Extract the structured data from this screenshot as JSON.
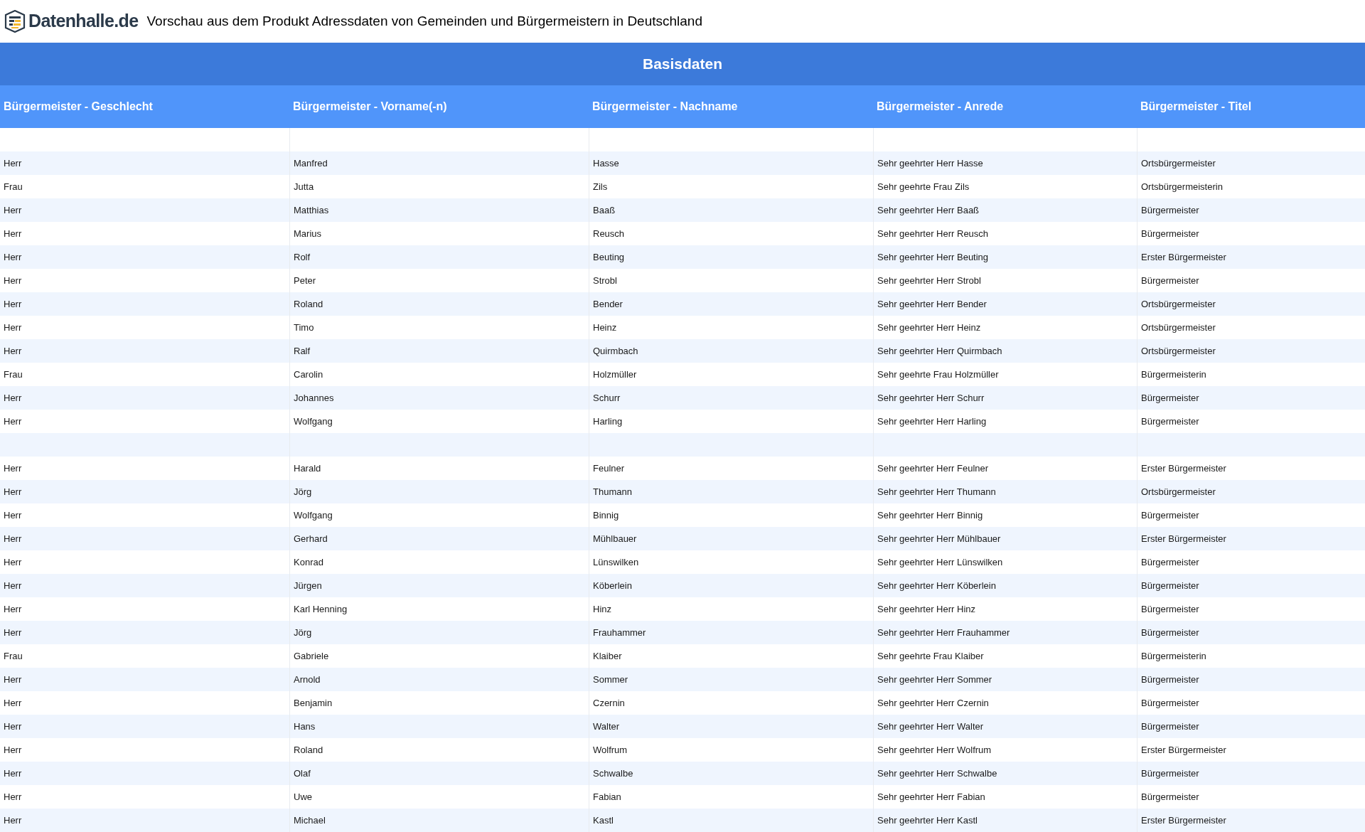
{
  "header": {
    "logo_text": "Datenhalle.de",
    "title": "Vorschau aus dem Produkt Adressdaten von Gemeinden und Bürgermeistern in Deutschland"
  },
  "table": {
    "group_title": "Basisdaten",
    "columns": [
      "Bürgermeister - Geschlecht",
      "Bürgermeister - Vorname(-n)",
      "Bürgermeister - Nachname",
      "Bürgermeister - Anrede",
      "Bürgermeister - Titel"
    ],
    "rows": [
      {
        "kind": "blank"
      },
      {
        "kind": "data",
        "cells": [
          "Herr",
          "Manfred",
          "Hasse",
          "Sehr geehrter Herr Hasse",
          "Ortsbürgermeister"
        ]
      },
      {
        "kind": "data",
        "cells": [
          "Frau",
          "Jutta",
          "Zils",
          "Sehr geehrte Frau Zils",
          "Ortsbürgermeisterin"
        ]
      },
      {
        "kind": "data",
        "cells": [
          "Herr",
          "Matthias",
          "Baaß",
          "Sehr geehrter Herr Baaß",
          "Bürgermeister"
        ]
      },
      {
        "kind": "data",
        "cells": [
          "Herr",
          "Marius",
          "Reusch",
          "Sehr geehrter Herr Reusch",
          "Bürgermeister"
        ]
      },
      {
        "kind": "data",
        "cells": [
          "Herr",
          "Rolf",
          "Beuting",
          "Sehr geehrter Herr Beuting",
          "Erster Bürgermeister"
        ]
      },
      {
        "kind": "data",
        "cells": [
          "Herr",
          "Peter",
          "Strobl",
          "Sehr geehrter Herr Strobl",
          "Bürgermeister"
        ]
      },
      {
        "kind": "data",
        "cells": [
          "Herr",
          "Roland",
          "Bender",
          "Sehr geehrter Herr Bender",
          "Ortsbürgermeister"
        ]
      },
      {
        "kind": "data",
        "cells": [
          "Herr",
          "Timo",
          "Heinz",
          "Sehr geehrter Herr Heinz",
          "Ortsbürgermeister"
        ]
      },
      {
        "kind": "data",
        "cells": [
          "Herr",
          "Ralf",
          "Quirmbach",
          "Sehr geehrter Herr Quirmbach",
          "Ortsbürgermeister"
        ]
      },
      {
        "kind": "data",
        "cells": [
          "Frau",
          "Carolin",
          "Holzmüller",
          "Sehr geehrte Frau Holzmüller",
          "Bürgermeisterin"
        ]
      },
      {
        "kind": "data",
        "cells": [
          "Herr",
          "Johannes",
          "Schurr",
          "Sehr geehrter Herr Schurr",
          "Bürgermeister"
        ]
      },
      {
        "kind": "data",
        "cells": [
          "Herr",
          "Wolfgang",
          "Harling",
          "Sehr geehrter Herr Harling",
          "Bürgermeister"
        ]
      },
      {
        "kind": "blank"
      },
      {
        "kind": "data",
        "cells": [
          "Herr",
          "Harald",
          "Feulner",
          "Sehr geehrter Herr Feulner",
          "Erster Bürgermeister"
        ]
      },
      {
        "kind": "data",
        "cells": [
          "Herr",
          "Jörg",
          "Thumann",
          "Sehr geehrter Herr Thumann",
          "Ortsbürgermeister"
        ]
      },
      {
        "kind": "data",
        "cells": [
          "Herr",
          "Wolfgang",
          "Binnig",
          "Sehr geehrter Herr Binnig",
          "Bürgermeister"
        ]
      },
      {
        "kind": "data",
        "cells": [
          "Herr",
          "Gerhard",
          "Mühlbauer",
          "Sehr geehrter Herr Mühlbauer",
          "Erster Bürgermeister"
        ]
      },
      {
        "kind": "data",
        "cells": [
          "Herr",
          "Konrad",
          "Lünswilken",
          "Sehr geehrter Herr Lünswilken",
          "Bürgermeister"
        ]
      },
      {
        "kind": "data",
        "cells": [
          "Herr",
          "Jürgen",
          "Köberlein",
          "Sehr geehrter Herr Köberlein",
          "Bürgermeister"
        ]
      },
      {
        "kind": "data",
        "cells": [
          "Herr",
          "Karl Henning",
          "Hinz",
          "Sehr geehrter Herr Hinz",
          "Bürgermeister"
        ]
      },
      {
        "kind": "data",
        "cells": [
          "Herr",
          "Jörg",
          "Frauhammer",
          "Sehr geehrter Herr Frauhammer",
          "Bürgermeister"
        ]
      },
      {
        "kind": "data",
        "cells": [
          "Frau",
          "Gabriele",
          "Klaiber",
          "Sehr geehrte Frau Klaiber",
          "Bürgermeisterin"
        ]
      },
      {
        "kind": "data",
        "cells": [
          "Herr",
          "Arnold",
          "Sommer",
          "Sehr geehrter Herr Sommer",
          "Bürgermeister"
        ]
      },
      {
        "kind": "data",
        "cells": [
          "Herr",
          "Benjamin",
          "Czernin",
          "Sehr geehrter Herr Czernin",
          "Bürgermeister"
        ]
      },
      {
        "kind": "data",
        "cells": [
          "Herr",
          "Hans",
          "Walter",
          "Sehr geehrter Herr Walter",
          "Bürgermeister"
        ]
      },
      {
        "kind": "data",
        "cells": [
          "Herr",
          "Roland",
          "Wolfrum",
          "Sehr geehrter Herr Wolfrum",
          "Erster Bürgermeister"
        ]
      },
      {
        "kind": "data",
        "cells": [
          "Herr",
          "Olaf",
          "Schwalbe",
          "Sehr geehrter Herr Schwalbe",
          "Bürgermeister"
        ]
      },
      {
        "kind": "data",
        "cells": [
          "Herr",
          "Uwe",
          "Fabian",
          "Sehr geehrter Herr Fabian",
          "Bürgermeister"
        ]
      },
      {
        "kind": "data",
        "cells": [
          "Herr",
          "Michael",
          "Kastl",
          "Sehr geehrter Herr Kastl",
          "Erster Bürgermeister"
        ]
      }
    ]
  }
}
